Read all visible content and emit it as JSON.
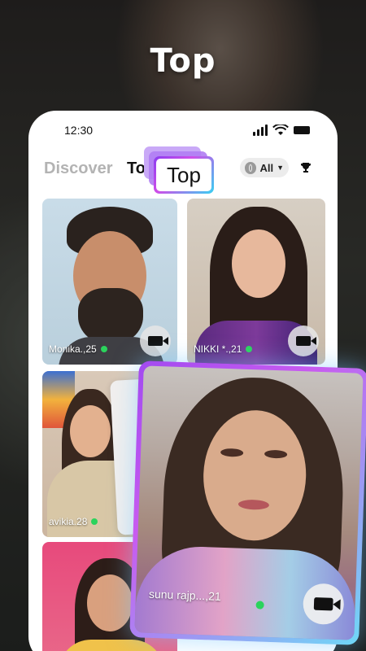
{
  "headline": "Top",
  "status_bar": {
    "time": "12:30"
  },
  "tabs": {
    "discover": "Discover",
    "top": "Top"
  },
  "filter": {
    "label": "All",
    "icon": "globe-icon"
  },
  "badge": {
    "label": "Top"
  },
  "cards": [
    {
      "name": "Monika.,25",
      "online": true
    },
    {
      "name": "NIKKI *.,21",
      "online": true
    },
    {
      "name": "avikia.28",
      "online": true
    },
    {
      "name": "",
      "online": false
    }
  ],
  "featured_card": {
    "name": "sunu rajp...,21",
    "online": true
  },
  "colors": {
    "accent_purple": "#a24bf0",
    "accent_cyan": "#6fd8f6",
    "online_green": "#2bd35c"
  }
}
